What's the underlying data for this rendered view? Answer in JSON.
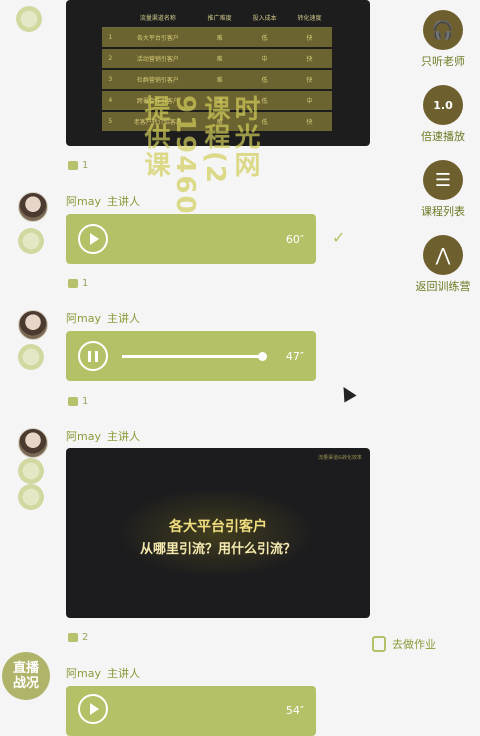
{
  "table_card": {
    "headers": [
      "流量渠道名称",
      "推广难度",
      "投入成本",
      "转化速度"
    ],
    "rows": [
      [
        "1",
        "各大平台引客户",
        "难",
        "低",
        "快"
      ],
      [
        "2",
        "活动营销引客户",
        "难",
        "中",
        "快"
      ],
      [
        "3",
        "社群营销引客户",
        "难",
        "低",
        "快"
      ],
      [
        "4",
        "跨界合作引客户",
        "难",
        "低",
        "中"
      ],
      [
        "5",
        "老客户转介绍客户",
        "难",
        "低",
        "快"
      ]
    ]
  },
  "watermark": {
    "lines": [
      "时光网",
      "课程(2",
      "919460",
      "提供课"
    ]
  },
  "messages": [
    {
      "sender": "阿may",
      "role": "主讲人",
      "duration": "60″",
      "likes": "1"
    },
    {
      "sender": "阿may",
      "role": "主讲人",
      "duration": "47″",
      "likes": "1"
    },
    {
      "sender": "阿may",
      "role": "主讲人",
      "likes": "2"
    },
    {
      "sender": "阿may",
      "role": "主讲人",
      "duration": "54″"
    }
  ],
  "first_likes": "1",
  "slide": {
    "title": "各大平台引客户",
    "subtitle": "从哪里引流？用什么引流？",
    "corner_text": "流量渠道&转化效率"
  },
  "right_menu": [
    {
      "label": "只听老师",
      "icon": "headphones-icon",
      "glyph": "🎧"
    },
    {
      "label": "倍速播放",
      "icon": "speed-icon",
      "glyph": "1.0"
    },
    {
      "label": "课程列表",
      "icon": "list-icon",
      "glyph": "☰"
    },
    {
      "label": "返回训练营",
      "icon": "return-icon",
      "glyph": "⋀"
    }
  ],
  "homework_label": "去做作业",
  "live_button": {
    "label": "直播\n战况"
  },
  "progress": {
    "voice2_fraction": 1.0
  }
}
